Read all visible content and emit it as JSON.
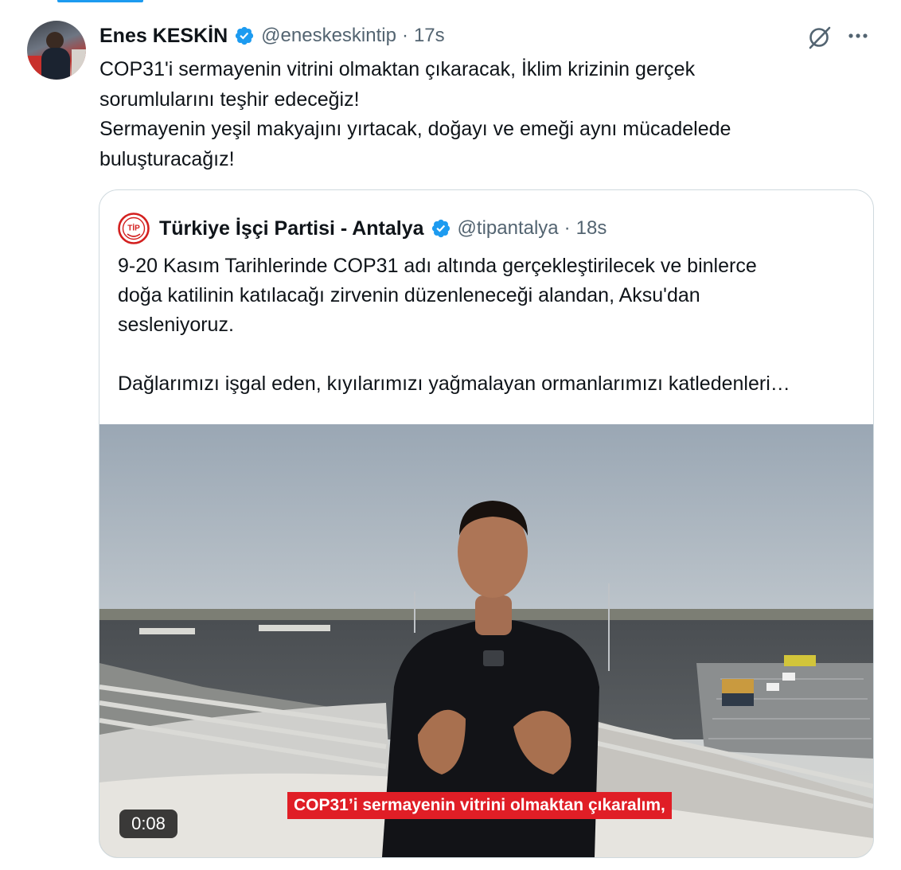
{
  "tweet": {
    "author_name": "Enes KESKİN",
    "handle": "@eneskeskintip",
    "separator": "·",
    "time": "17s",
    "text": "COP31'i sermayenin vitrini olmaktan çıkaracak, İklim krizinin gerçek\nsorumlularını teşhir edeceğiz!\nSermayenin yeşil makyajını yırtacak, doğayı ve emeği aynı mücadelede\nbuluşturacağız!",
    "icons": {
      "verified": "verified-badge-icon",
      "grok": "grok-icon",
      "more": "more-options-icon"
    }
  },
  "quoted_tweet": {
    "logo_text": "TİP",
    "author_name": "Türkiye İşçi Partisi - Antalya",
    "handle": "@tipantalya",
    "separator": "·",
    "time": "18s",
    "text": "9-20 Kasım Tarihlerinde COP31 adı altında gerçekleştirilecek ve binlerce\ndoğa katilinin katılacağı zirvenin düzenleneceği alandan, Aksu'dan\nsesleniyoruz.\n\nDağlarımızı işgal eden, kıyılarımızı yağmalayan ormanlarımızı katledenleri…"
  },
  "video": {
    "subtitle": "COP31’i sermayenin vitrini olmaktan çıkaralım,",
    "duration": "0:08"
  },
  "colors": {
    "accent": "#1d9bf0",
    "text_primary": "#0f1419",
    "text_secondary": "#536471",
    "border": "#cfd9de",
    "subtitle_bg": "#e01e26",
    "tip_logo_red": "#d3201f"
  }
}
